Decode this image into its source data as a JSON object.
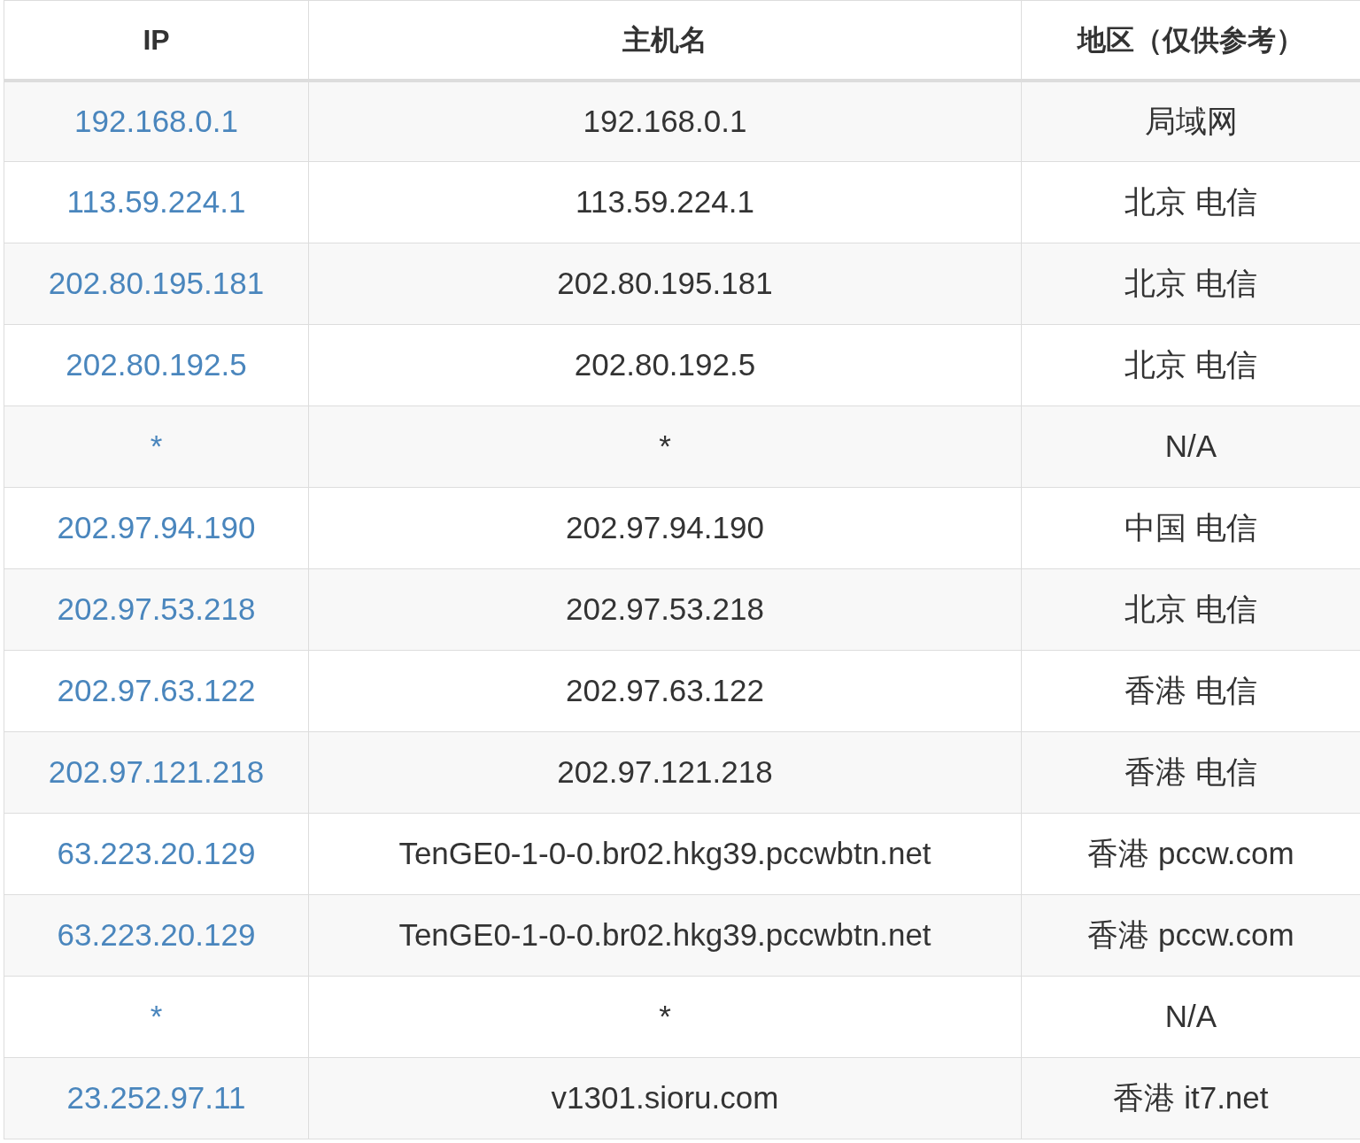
{
  "table": {
    "columns": [
      "IP",
      "主机名",
      "地区（仅供参考）"
    ],
    "rows": [
      {
        "ip": "192.168.0.1",
        "hostname": "192.168.0.1",
        "region": "局域网"
      },
      {
        "ip": "113.59.224.1",
        "hostname": "113.59.224.1",
        "region": "北京 电信"
      },
      {
        "ip": "202.80.195.181",
        "hostname": "202.80.195.181",
        "region": "北京 电信"
      },
      {
        "ip": "202.80.192.5",
        "hostname": "202.80.192.5",
        "region": "北京 电信"
      },
      {
        "ip": "*",
        "hostname": "*",
        "region": "N/A"
      },
      {
        "ip": "202.97.94.190",
        "hostname": "202.97.94.190",
        "region": "中国 电信"
      },
      {
        "ip": "202.97.53.218",
        "hostname": "202.97.53.218",
        "region": "北京 电信"
      },
      {
        "ip": "202.97.63.122",
        "hostname": "202.97.63.122",
        "region": "香港 电信"
      },
      {
        "ip": "202.97.121.218",
        "hostname": "202.97.121.218",
        "region": "香港 电信"
      },
      {
        "ip": "63.223.20.129",
        "hostname": "TenGE0-1-0-0.br02.hkg39.pccwbtn.net",
        "region": "香港 pccw.com"
      },
      {
        "ip": "63.223.20.129",
        "hostname": "TenGE0-1-0-0.br02.hkg39.pccwbtn.net",
        "region": "香港 pccw.com"
      },
      {
        "ip": "*",
        "hostname": "*",
        "region": "N/A"
      },
      {
        "ip": "23.252.97.11",
        "hostname": "v1301.sioru.com",
        "region": "香港 it7.net"
      }
    ]
  }
}
